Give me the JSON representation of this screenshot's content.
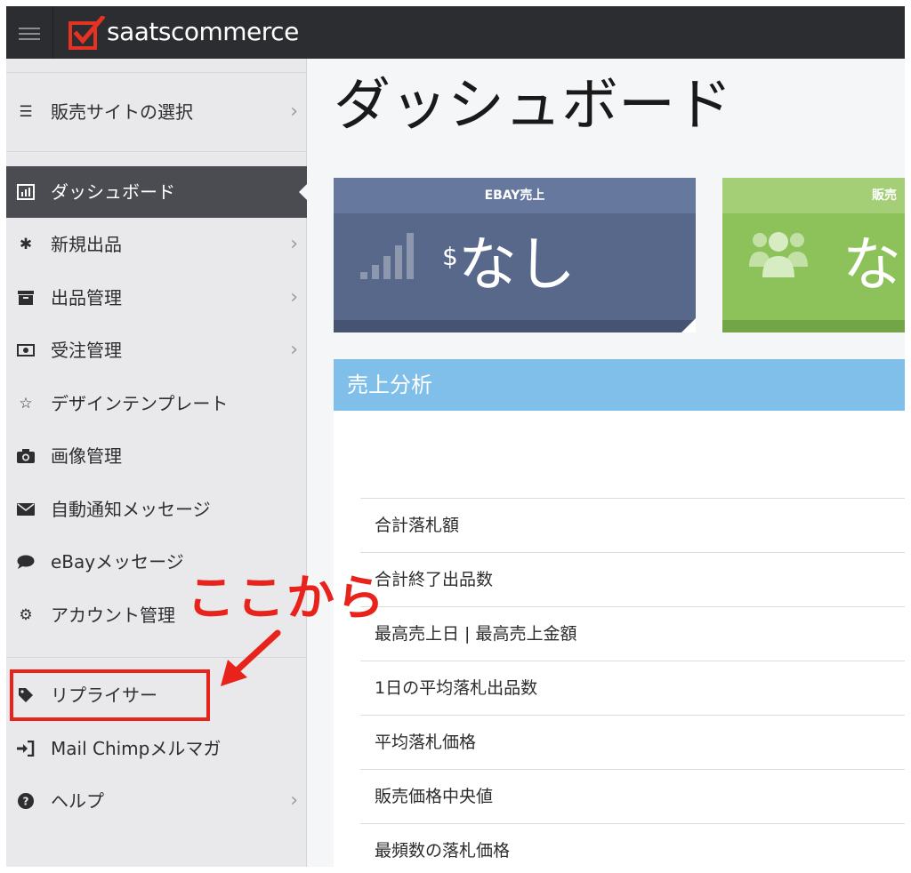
{
  "app": {
    "brand": "saatscommerce",
    "colors": {
      "topbar": "#2b2d31",
      "sidebar": "#e9e9eb",
      "active": "#4a4c51",
      "accent_red": "#e8231c",
      "panel_blue": "#7fbfe9",
      "ebay_card": "#58688a",
      "sales_card": "#8dc25b"
    }
  },
  "sidebar": {
    "items": [
      {
        "label": "販売サイトの選択",
        "icon": "list-icon",
        "chevron": "›"
      },
      {
        "label": "ダッシュボード",
        "icon": "bar-chart-icon"
      },
      {
        "label": "新規出品",
        "icon": "asterisk-icon",
        "chevron": "›"
      },
      {
        "label": "出品管理",
        "icon": "archive-box-icon",
        "chevron": "›"
      },
      {
        "label": "受注管理",
        "icon": "money-icon",
        "chevron": "›"
      },
      {
        "label": "デザインテンプレート",
        "icon": "star-half-icon"
      },
      {
        "label": "画像管理",
        "icon": "camera-icon"
      },
      {
        "label": "自動通知メッセージ",
        "icon": "envelope-icon"
      },
      {
        "label": "eBayメッセージ",
        "icon": "speech-bubble-icon"
      },
      {
        "label": "アカウント管理",
        "icon": "gears-icon"
      },
      {
        "label": "リプライサー",
        "icon": "tag-icon"
      },
      {
        "label": "Mail Chimpメルマガ",
        "icon": "sign-in-icon"
      },
      {
        "label": "ヘルプ",
        "icon": "question-circle-icon",
        "chevron": "›"
      }
    ]
  },
  "main": {
    "title": "ダッシュボード",
    "cards": [
      {
        "header": "EBAY売上",
        "currency": "$",
        "value": "なし",
        "icon": "signal-bars-icon"
      },
      {
        "header": "販売",
        "value": "な",
        "icon": "users-icon"
      }
    ],
    "panel": {
      "title": "売上分析",
      "rows": [
        "合計落札額",
        "合計終了出品数",
        "最高売上日 | 最高売上金額",
        "1日の平均落札出品数",
        "平均落札価格",
        "販売価格中央値",
        "最頻数の落札価格"
      ]
    }
  },
  "annotation": {
    "text": "ここから"
  }
}
